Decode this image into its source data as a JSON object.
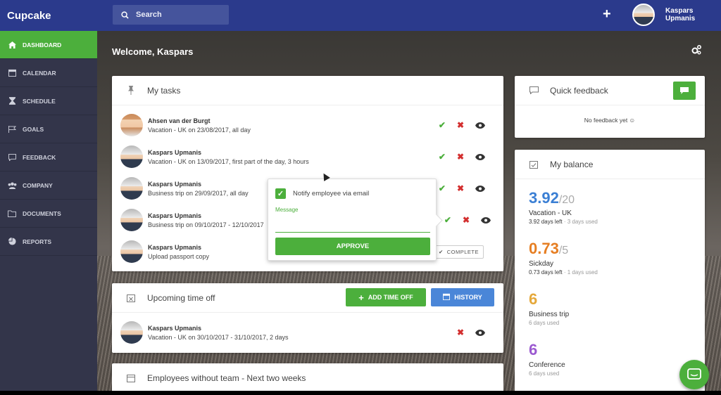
{
  "app": {
    "brand": "Cupcake"
  },
  "search": {
    "placeholder": "Search"
  },
  "user": {
    "name": "Kaspars Upmanis"
  },
  "sidebar": {
    "items": [
      {
        "label": "DASHBOARD",
        "icon": "home-icon",
        "active": true
      },
      {
        "label": "CALENDAR",
        "icon": "calendar-icon"
      },
      {
        "label": "SCHEDULE",
        "icon": "hourglass-icon"
      },
      {
        "label": "GOALS",
        "icon": "flag-icon"
      },
      {
        "label": "FEEDBACK",
        "icon": "comment-icon"
      },
      {
        "label": "COMPANY",
        "icon": "users-icon"
      },
      {
        "label": "DOCUMENTS",
        "icon": "folder-icon"
      },
      {
        "label": "REPORTS",
        "icon": "pie-chart-icon"
      }
    ]
  },
  "main": {
    "welcome": "Welcome, Kaspars"
  },
  "tasks": {
    "title": "My tasks",
    "rows": [
      {
        "name": "Ahsen van der Burgt",
        "desc": "Vacation - UK on 23/08/2017, all day"
      },
      {
        "name": "Kaspars Upmanis",
        "desc": "Vacation - UK on 13/09/2017, first part of the day, 3 hours"
      },
      {
        "name": "Kaspars Upmanis",
        "desc": "Business trip on 29/09/2017, all day"
      },
      {
        "name": "Kaspars Upmanis",
        "desc": "Business trip on 09/10/2017 - 12/10/2017"
      },
      {
        "name": "Kaspars Upmanis",
        "desc": "Upload passport copy"
      }
    ],
    "complete_label": "COMPLETE"
  },
  "popup": {
    "notify_label": "Notify employee via email",
    "message_label": "Message",
    "message_value": "",
    "approve_label": "APPROVE"
  },
  "upcoming": {
    "title": "Upcoming time off",
    "add_label": "ADD TIME OFF",
    "history_label": "HISTORY",
    "row": {
      "name": "Kaspars Upmanis",
      "desc": "Vacation - UK on 30/10/2017 - 31/10/2017, 2 days"
    }
  },
  "employees": {
    "title": "Employees without team - Next two weeks"
  },
  "feedback": {
    "title": "Quick feedback",
    "empty": "No feedback yet ☺"
  },
  "balance": {
    "title": "My balance",
    "items": [
      {
        "value": "3.92",
        "total": "/20",
        "label": "Vacation - UK",
        "sub_main": "3.92 days left",
        "sub_muted": " · 3 days used",
        "color": "#3b7fd4"
      },
      {
        "value": "0.73",
        "total": "/5",
        "label": "Sickday",
        "sub_main": "0.73 days left",
        "sub_muted": " · 1 days used",
        "color": "#e67e22"
      },
      {
        "value": "6",
        "total": "",
        "label": "Business trip",
        "sub_main": "",
        "sub_muted": "6 days used",
        "color": "#e5a83a"
      },
      {
        "value": "6",
        "total": "",
        "label": "Conference",
        "sub_main": "",
        "sub_muted": "6 days used",
        "color": "#9b59d0"
      }
    ]
  },
  "colors": {
    "topbar": "#2b3a8c",
    "sidebar": "#33354a",
    "accent": "#4caf3c",
    "blue": "#4a86d8"
  }
}
